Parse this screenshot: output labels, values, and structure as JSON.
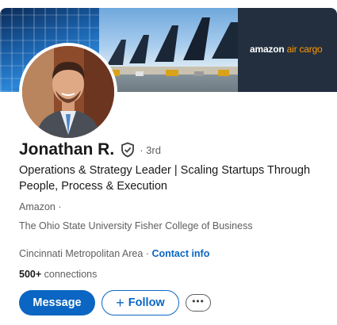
{
  "banner": {
    "logo_brand": "amazon",
    "logo_accent": "air cargo",
    "colors": {
      "dark_panel": "#232f3e",
      "accent": "#ff9900"
    }
  },
  "profile": {
    "name": "Jonathan R.",
    "degree": "· 3rd",
    "headline": "Operations & Strategy Leader | Scaling Startups Through People, Process & Execution",
    "company": "Amazon ·",
    "school": "The Ohio State University Fisher College of Business",
    "location": "Cincinnati Metropolitan Area",
    "location_separator": " · ",
    "contact_label": "Contact info",
    "connections_count": "500+",
    "connections_label": "connections"
  },
  "actions": {
    "message_label": "Message",
    "follow_plus": "+",
    "follow_label": "Follow",
    "more_label": "•••"
  },
  "icons": {
    "verified": "shield-check-icon",
    "more": "ellipsis-icon"
  },
  "colors": {
    "primary": "#0a66c2",
    "text_primary": "#191919",
    "text_secondary": "#5e5e5e"
  }
}
